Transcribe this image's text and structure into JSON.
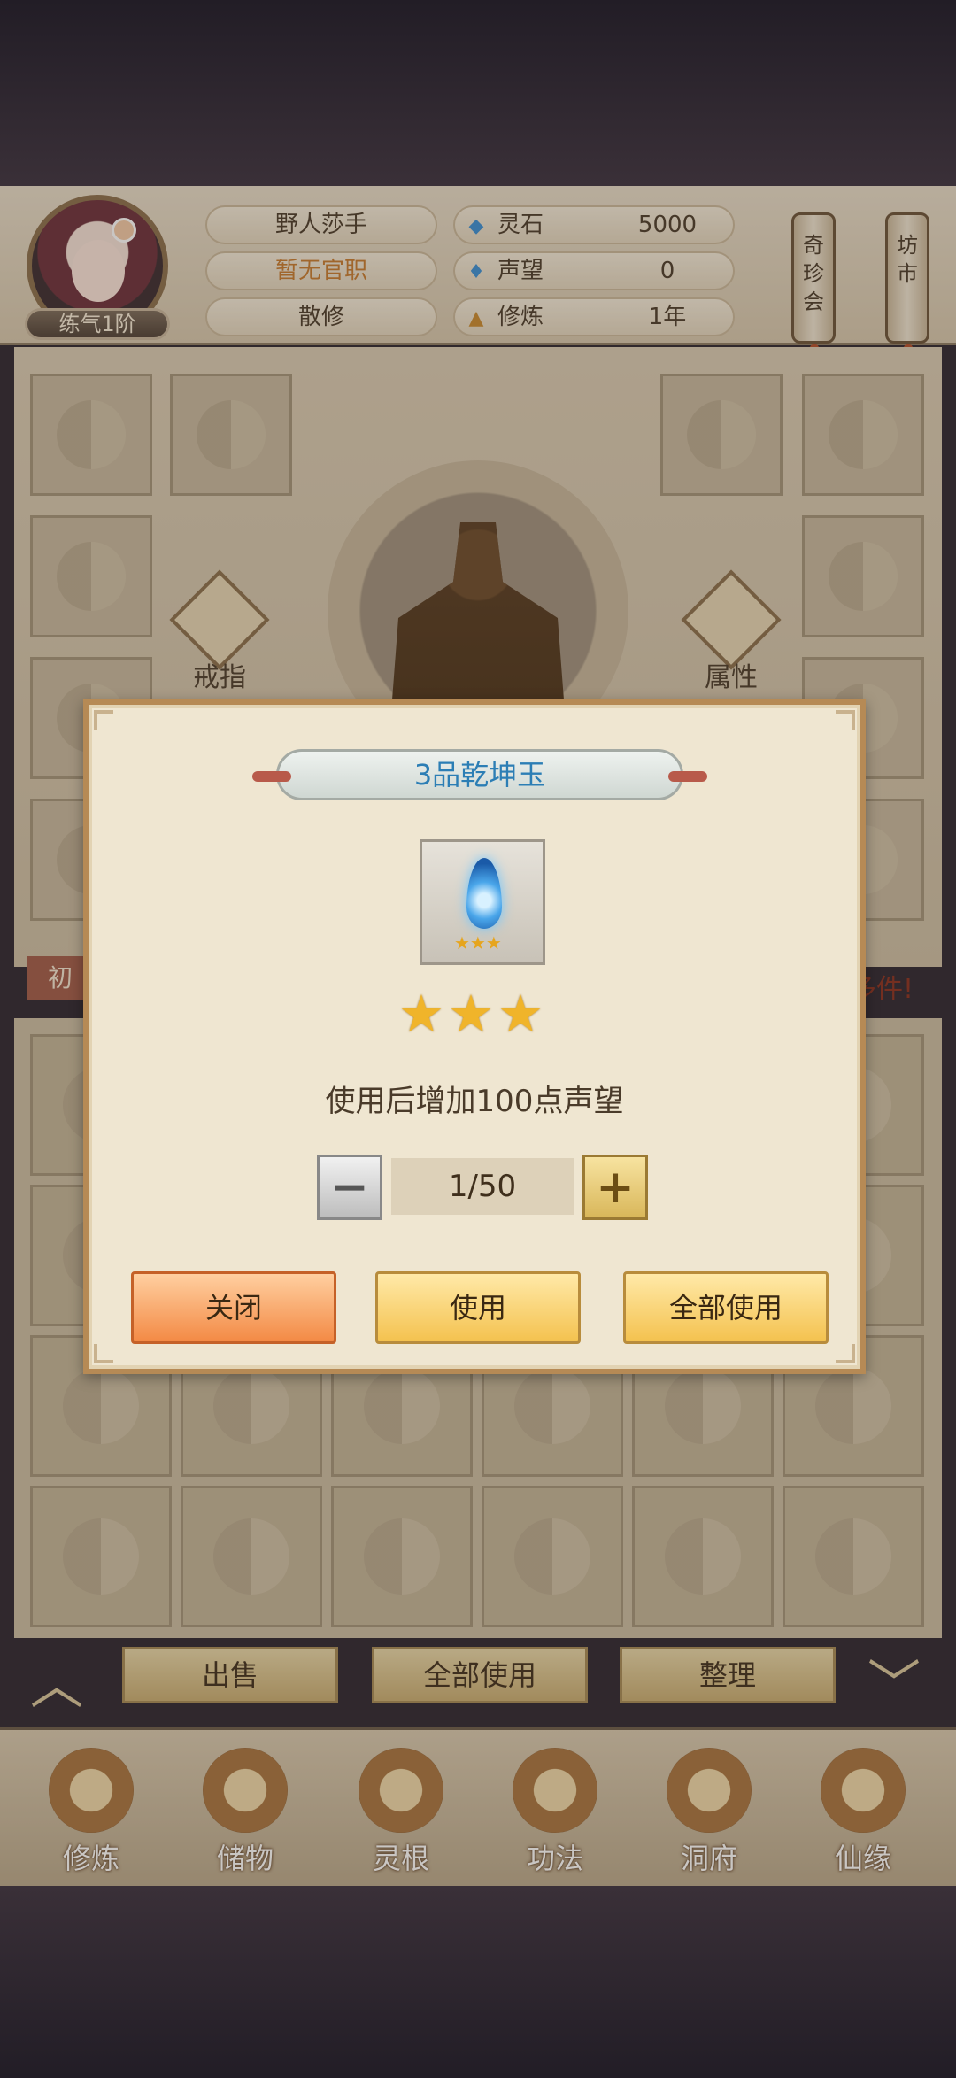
{
  "header": {
    "player_name": "野人莎手",
    "official_rank": "暂无官职",
    "sect": "散修",
    "realm": "练气1阶",
    "stats": [
      {
        "label": "灵石",
        "value": "5000",
        "icon": "spirit-stone-icon"
      },
      {
        "label": "声望",
        "value": "0",
        "icon": "reputation-icon"
      },
      {
        "label": "修炼",
        "value": "1年",
        "icon": "meditation-icon"
      }
    ],
    "scroll_buttons": [
      "奇珍会",
      "坊市"
    ]
  },
  "equipment": {
    "ring_label": "戒指",
    "attributes_label": "属性",
    "banner_left": "初",
    "banner_right": "多件!"
  },
  "inventory": {
    "sell_label": "出售",
    "use_all_label": "全部使用",
    "sort_label": "整理"
  },
  "nav": {
    "items": [
      "修炼",
      "储物",
      "灵根",
      "功法",
      "洞府",
      "仙缘"
    ]
  },
  "dialog": {
    "title": "3品乾坤玉",
    "stars": "★★★",
    "mini_stars": "★★★",
    "description": "使用后增加100点声望",
    "quantity": "1/50",
    "minus": "−",
    "plus": "+",
    "close_label": "关闭",
    "use_label": "使用",
    "use_all_label": "全部使用"
  },
  "colors": {
    "title_blue": "#2c7eb5",
    "close_orange": "#f38a45",
    "use_gold": "#f4c24f"
  }
}
